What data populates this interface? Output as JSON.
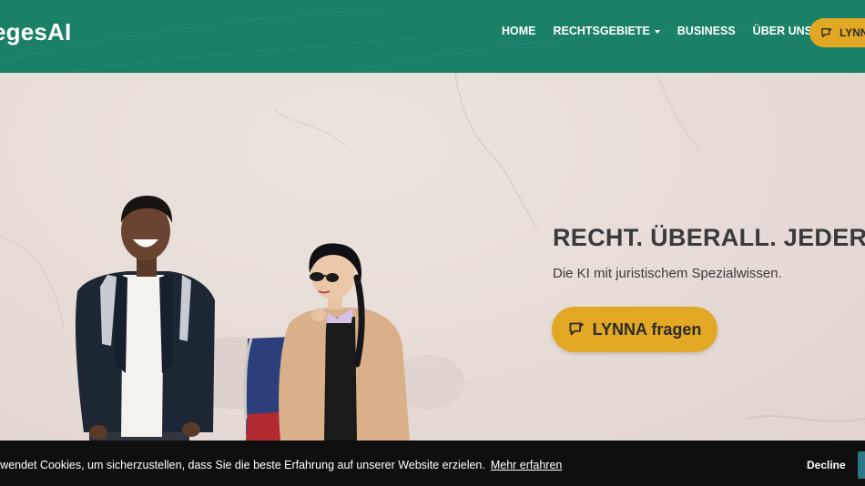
{
  "nav": {
    "logo": "egesAI",
    "items": [
      {
        "label": "HOME"
      },
      {
        "label": "RECHTSGEBIETE"
      },
      {
        "label": "BUSINESS"
      },
      {
        "label": "ÜBER UNS"
      }
    ],
    "cta_label": "LYNN"
  },
  "hero": {
    "headline": "RECHT. ÜBERALL. JEDERZE",
    "subline": "Die KI mit juristischem Spezialwissen.",
    "cta_label": "LYNNA fragen"
  },
  "cookie": {
    "text": "rwendet Cookies, um sicherzustellen, dass Sie die beste Erfahrung auf unserer Website erzielen.",
    "link": "Mehr erfahren",
    "decline": "Decline"
  },
  "colors": {
    "nav_bg": "#1a8068",
    "cta": "#e3a823",
    "cookie_bg": "#0f0f0f",
    "accept_btn": "#2b7a86"
  },
  "icons": {
    "cta_icon": "chat-sparkle-icon",
    "dropdown": "caret-down-icon"
  }
}
